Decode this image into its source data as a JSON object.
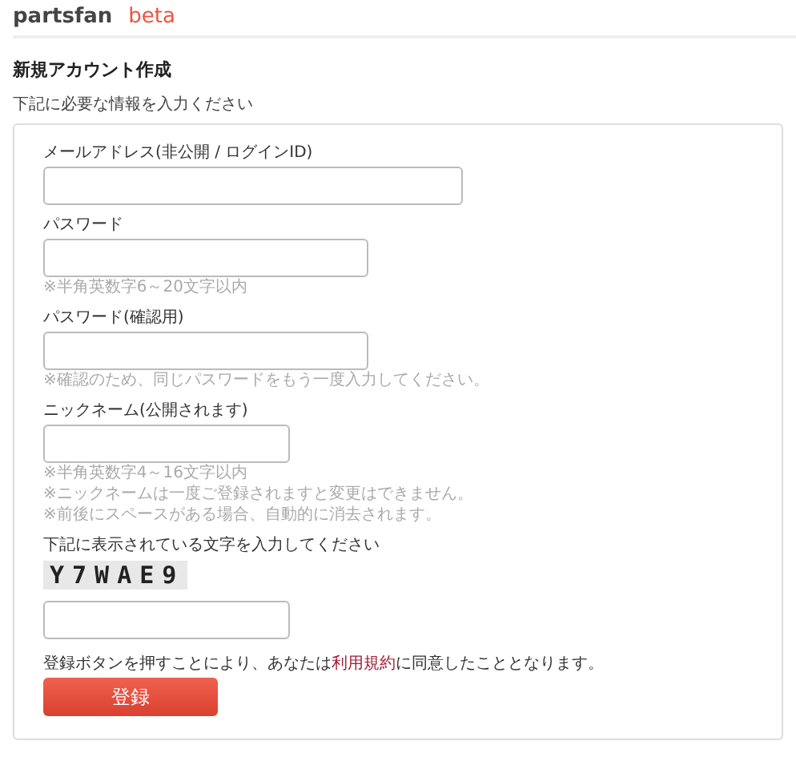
{
  "header": {
    "logo": "partsfan",
    "badge": "beta"
  },
  "title": "新規アカウント作成",
  "subtitle": "下記に必要な情報を入力ください",
  "fields": [
    {
      "kind": "email",
      "label": "メールアドレス(非公開 / ログインID)"
    },
    {
      "kind": "password",
      "label": "パスワード",
      "notes": [
        "※半角英数字6～20文字以内"
      ]
    },
    {
      "kind": "password",
      "label": "パスワード(確認用)",
      "notes": [
        "※確認のため、同じパスワードをもう一度入力してください。"
      ]
    },
    {
      "kind": "short",
      "label": "ニックネーム(公開されます)",
      "notes": [
        "※半角英数字4～16文字以内",
        "※ニックネームは一度ご登録されますと変更はできません。",
        "※前後にスペースがある場合、自動的に消去されます。"
      ]
    }
  ],
  "captcha": {
    "label": "下記に表示されている文字を入力してください",
    "code": "Y7WAE9"
  },
  "terms": {
    "before": "登録ボタンを押すことにより、あなたは",
    "link": "利用規約",
    "after": "に同意したこととなります。"
  },
  "submit": "登録"
}
